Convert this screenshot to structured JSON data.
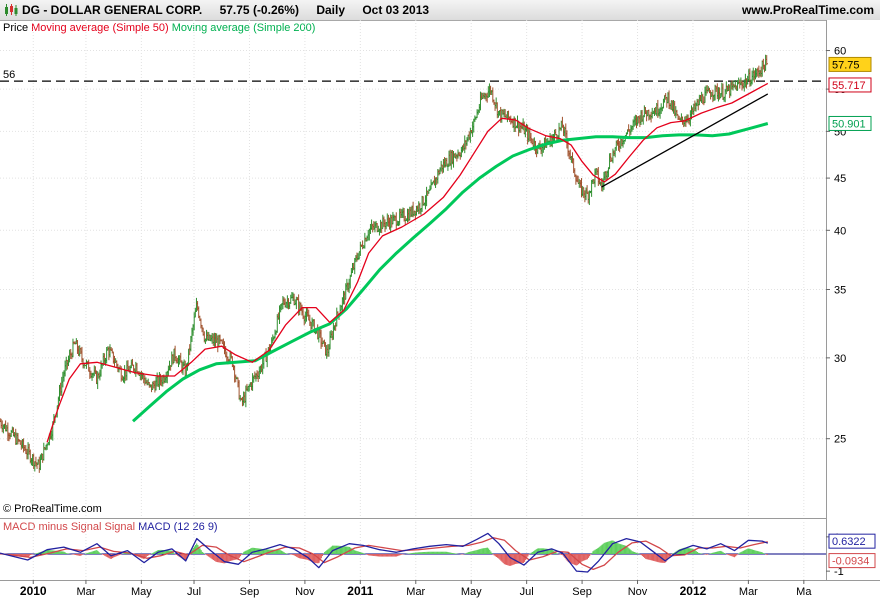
{
  "header": {
    "symbol": "DG - DOLLAR GENERAL CORP.",
    "quote": "57.75 (-0.26%)",
    "period": "Daily",
    "date": "Oct 03 2013",
    "site": "www.ProRealTime.com"
  },
  "legend": {
    "price": "Price",
    "sma50": "Moving average (Simple 50)",
    "sma200": "Moving average (Simple 200)"
  },
  "macd_legend": {
    "hist": "MACD minus Signal Signal",
    "macd": "MACD (12 26 9)"
  },
  "copyright": "© ProRealTime.com",
  "colors": {
    "price": "#2f7a2f",
    "sma50": "#e4001b",
    "sma200": "#00c85a",
    "macd_line": "#2222a0",
    "signal_line": "#d2474a",
    "hist_pos": "#5fcf5f",
    "hist_neg": "#e06060",
    "grid": "#e2e2e2",
    "current_price_bg": "#ffd21a"
  },
  "chart_data": [
    {
      "type": "line",
      "scale": "log",
      "ylim": [
        21,
        62
      ],
      "yticks": [
        25,
        30,
        35,
        40,
        45,
        50,
        55,
        60
      ],
      "xticks": [
        "2010",
        "Mar",
        "May",
        "Jul",
        "Sep",
        "Nov",
        "2011",
        "Mar",
        "May",
        "Jul",
        "Sep",
        "Nov",
        "2012",
        "Mar",
        "Ma"
      ],
      "xtick_pos": [
        0.7,
        2.6,
        4.6,
        6.5,
        8.5,
        10.5,
        12.5,
        14.5,
        16.5,
        18.5,
        20.5,
        22.5,
        24.5,
        26.5,
        28.5
      ],
      "xlim": [
        -0.5,
        29.3
      ],
      "horizontal_line": {
        "value": 56,
        "label": "56",
        "style": "dashed"
      },
      "trendline": [
        [
          21.2,
          44.1
        ],
        [
          27.2,
          54.4
        ]
      ],
      "price_points": [
        [
          -0.5,
          26.0
        ],
        [
          0.3,
          24.6
        ],
        [
          0.9,
          23.5
        ],
        [
          1.4,
          25.7
        ],
        [
          1.8,
          29.0
        ],
        [
          2.2,
          31.0
        ],
        [
          2.5,
          29.8
        ],
        [
          3.0,
          28.6
        ],
        [
          3.4,
          30.6
        ],
        [
          3.9,
          28.9
        ],
        [
          4.4,
          29.5
        ],
        [
          4.9,
          28.0
        ],
        [
          5.4,
          28.7
        ],
        [
          5.8,
          30.3
        ],
        [
          6.2,
          29.0
        ],
        [
          6.6,
          33.8
        ],
        [
          6.9,
          31.3
        ],
        [
          7.4,
          31.1
        ],
        [
          7.9,
          29.7
        ],
        [
          8.2,
          27.0
        ],
        [
          8.6,
          28.5
        ],
        [
          8.9,
          29.3
        ],
        [
          9.3,
          31.0
        ],
        [
          9.7,
          34.0
        ],
        [
          10.1,
          34.3
        ],
        [
          10.5,
          33.0
        ],
        [
          10.9,
          32.0
        ],
        [
          11.3,
          30.3
        ],
        [
          11.6,
          32.6
        ],
        [
          12.0,
          35.0
        ],
        [
          12.4,
          37.8
        ],
        [
          12.8,
          40.0
        ],
        [
          13.3,
          40.6
        ],
        [
          13.8,
          41.0
        ],
        [
          14.2,
          41.4
        ],
        [
          14.6,
          42.2
        ],
        [
          15.0,
          43.5
        ],
        [
          15.4,
          46.1
        ],
        [
          15.8,
          47.2
        ],
        [
          16.2,
          48.0
        ],
        [
          16.6,
          51.0
        ],
        [
          16.9,
          54.0
        ],
        [
          17.2,
          55.0
        ],
        [
          17.5,
          52.0
        ],
        [
          17.9,
          51.5
        ],
        [
          18.4,
          50.2
        ],
        [
          18.9,
          48.1
        ],
        [
          19.4,
          49.1
        ],
        [
          19.8,
          50.6
        ],
        [
          20.1,
          47.0
        ],
        [
          20.4,
          44.0
        ],
        [
          20.7,
          43.3
        ],
        [
          21.0,
          45.5
        ],
        [
          21.2,
          44.1
        ],
        [
          21.5,
          47.0
        ],
        [
          21.9,
          49.0
        ],
        [
          22.3,
          50.5
        ],
        [
          22.7,
          52.1
        ],
        [
          23.2,
          52.5
        ],
        [
          23.6,
          54.0
        ],
        [
          24.0,
          51.0
        ],
        [
          24.4,
          51.8
        ],
        [
          24.8,
          53.8
        ],
        [
          25.2,
          54.8
        ],
        [
          25.6,
          54.5
        ],
        [
          26.0,
          55.2
        ],
        [
          26.4,
          56.0
        ],
        [
          26.8,
          57.0
        ],
        [
          27.1,
          58.2
        ],
        [
          27.2,
          57.75
        ]
      ],
      "sma50_points": [
        [
          1.2,
          24.8
        ],
        [
          1.6,
          26.8
        ],
        [
          2.0,
          28.6
        ],
        [
          2.4,
          29.6
        ],
        [
          3.0,
          29.7
        ],
        [
          3.6,
          29.4
        ],
        [
          4.4,
          29.0
        ],
        [
          5.2,
          28.8
        ],
        [
          5.8,
          28.8
        ],
        [
          6.4,
          29.7
        ],
        [
          6.9,
          30.6
        ],
        [
          7.5,
          30.8
        ],
        [
          8.0,
          30.2
        ],
        [
          8.6,
          29.7
        ],
        [
          9.2,
          30.5
        ],
        [
          9.8,
          32.3
        ],
        [
          10.4,
          33.6
        ],
        [
          10.9,
          33.6
        ],
        [
          11.4,
          32.5
        ],
        [
          11.9,
          33.4
        ],
        [
          12.4,
          35.6
        ],
        [
          12.8,
          38.0
        ],
        [
          13.3,
          39.5
        ],
        [
          14.0,
          40.3
        ],
        [
          14.8,
          41.5
        ],
        [
          15.5,
          43.1
        ],
        [
          16.1,
          45.3
        ],
        [
          16.6,
          47.6
        ],
        [
          17.1,
          50.0
        ],
        [
          17.6,
          51.5
        ],
        [
          18.1,
          51.3
        ],
        [
          18.6,
          50.3
        ],
        [
          19.2,
          49.5
        ],
        [
          19.7,
          49.2
        ],
        [
          20.1,
          48.5
        ],
        [
          20.5,
          46.7
        ],
        [
          20.9,
          45.3
        ],
        [
          21.3,
          44.6
        ],
        [
          21.7,
          45.4
        ],
        [
          22.2,
          47.2
        ],
        [
          22.7,
          49.0
        ],
        [
          23.2,
          50.4
        ],
        [
          23.7,
          51.0
        ],
        [
          24.2,
          51.2
        ],
        [
          24.8,
          52.1
        ],
        [
          25.4,
          52.8
        ],
        [
          25.9,
          53.3
        ],
        [
          26.5,
          54.4
        ],
        [
          27.2,
          55.717
        ]
      ],
      "sma200_points": [
        [
          4.3,
          26.0
        ],
        [
          4.9,
          26.9
        ],
        [
          5.5,
          27.8
        ],
        [
          6.1,
          28.6
        ],
        [
          6.7,
          29.2
        ],
        [
          7.3,
          29.6
        ],
        [
          8.0,
          29.7
        ],
        [
          8.7,
          29.8
        ],
        [
          9.3,
          30.4
        ],
        [
          10.0,
          31.1
        ],
        [
          10.7,
          31.8
        ],
        [
          11.4,
          32.4
        ],
        [
          12.0,
          33.5
        ],
        [
          12.6,
          35.0
        ],
        [
          13.2,
          36.6
        ],
        [
          13.8,
          38.0
        ],
        [
          14.4,
          39.3
        ],
        [
          15.0,
          40.6
        ],
        [
          15.6,
          42.0
        ],
        [
          16.2,
          43.6
        ],
        [
          16.8,
          45.0
        ],
        [
          17.4,
          46.2
        ],
        [
          18.0,
          47.3
        ],
        [
          18.6,
          48.0
        ],
        [
          19.2,
          48.6
        ],
        [
          19.8,
          49.0
        ],
        [
          20.4,
          49.2
        ],
        [
          21.0,
          49.4
        ],
        [
          21.6,
          49.4
        ],
        [
          22.2,
          49.3
        ],
        [
          22.8,
          49.3
        ],
        [
          23.4,
          49.5
        ],
        [
          24.0,
          49.6
        ],
        [
          24.6,
          49.6
        ],
        [
          25.2,
          49.5
        ],
        [
          25.8,
          49.7
        ],
        [
          26.4,
          50.2
        ],
        [
          27.2,
          50.901
        ]
      ],
      "last_values": {
        "price": "57.75",
        "sma50": "55.717",
        "sma200": "50.901"
      }
    },
    {
      "type": "line",
      "name": "MACD (12 26 9)",
      "ylim": [
        -1.4,
        1.4
      ],
      "yticks": [
        1,
        -1
      ],
      "xlim": [
        -0.5,
        29.3
      ],
      "macd_points": [
        [
          -0.5,
          0.05
        ],
        [
          0.5,
          -0.35
        ],
        [
          1.2,
          0.25
        ],
        [
          1.8,
          0.4
        ],
        [
          2.4,
          0.1
        ],
        [
          3.0,
          0.6
        ],
        [
          3.5,
          -0.1
        ],
        [
          4.1,
          0.2
        ],
        [
          4.7,
          -0.5
        ],
        [
          5.2,
          0.1
        ],
        [
          5.7,
          0.3
        ],
        [
          6.2,
          -0.4
        ],
        [
          6.6,
          0.9
        ],
        [
          7.1,
          0.2
        ],
        [
          7.6,
          -0.45
        ],
        [
          8.1,
          -0.6
        ],
        [
          8.6,
          0.1
        ],
        [
          9.1,
          0.3
        ],
        [
          9.6,
          0.55
        ],
        [
          10.1,
          0.3
        ],
        [
          10.6,
          -0.2
        ],
        [
          11.0,
          -0.8
        ],
        [
          11.5,
          0.2
        ],
        [
          12.1,
          0.6
        ],
        [
          12.6,
          0.5
        ],
        [
          13.2,
          0.25
        ],
        [
          13.8,
          0.1
        ],
        [
          14.4,
          0.3
        ],
        [
          15.0,
          0.45
        ],
        [
          15.6,
          0.55
        ],
        [
          16.2,
          0.45
        ],
        [
          16.7,
          0.85
        ],
        [
          17.1,
          1.2
        ],
        [
          17.5,
          0.6
        ],
        [
          17.9,
          -0.2
        ],
        [
          18.4,
          -0.65
        ],
        [
          18.9,
          0.1
        ],
        [
          19.4,
          0.3
        ],
        [
          19.8,
          0.05
        ],
        [
          20.3,
          -1.0
        ],
        [
          20.7,
          -1.05
        ],
        [
          21.1,
          -0.4
        ],
        [
          21.6,
          0.6
        ],
        [
          22.1,
          0.9
        ],
        [
          22.6,
          0.7
        ],
        [
          23.1,
          0.1
        ],
        [
          23.5,
          -0.4
        ],
        [
          24.0,
          0.2
        ],
        [
          24.5,
          0.5
        ],
        [
          25.0,
          0.3
        ],
        [
          25.5,
          0.6
        ],
        [
          26.0,
          0.2
        ],
        [
          26.5,
          0.8
        ],
        [
          27.0,
          0.75
        ],
        [
          27.2,
          0.6322
        ]
      ],
      "signal_points": [
        [
          -0.5,
          0.02
        ],
        [
          0.6,
          -0.2
        ],
        [
          1.3,
          0.05
        ],
        [
          1.9,
          0.3
        ],
        [
          2.5,
          0.2
        ],
        [
          3.1,
          0.4
        ],
        [
          3.6,
          0.15
        ],
        [
          4.2,
          0.05
        ],
        [
          4.8,
          -0.25
        ],
        [
          5.3,
          -0.1
        ],
        [
          5.8,
          0.15
        ],
        [
          6.3,
          -0.05
        ],
        [
          6.8,
          0.5
        ],
        [
          7.3,
          0.4
        ],
        [
          7.8,
          -0.1
        ],
        [
          8.3,
          -0.45
        ],
        [
          8.8,
          -0.15
        ],
        [
          9.3,
          0.15
        ],
        [
          9.8,
          0.4
        ],
        [
          10.3,
          0.35
        ],
        [
          10.8,
          0.0
        ],
        [
          11.2,
          -0.5
        ],
        [
          11.7,
          -0.15
        ],
        [
          12.3,
          0.35
        ],
        [
          12.8,
          0.5
        ],
        [
          13.4,
          0.35
        ],
        [
          14.0,
          0.2
        ],
        [
          14.6,
          0.25
        ],
        [
          15.2,
          0.35
        ],
        [
          15.8,
          0.45
        ],
        [
          16.4,
          0.5
        ],
        [
          16.9,
          0.7
        ],
        [
          17.3,
          0.95
        ],
        [
          17.7,
          0.8
        ],
        [
          18.1,
          0.2
        ],
        [
          18.6,
          -0.35
        ],
        [
          19.1,
          -0.15
        ],
        [
          19.6,
          0.15
        ],
        [
          20.0,
          0.1
        ],
        [
          20.5,
          -0.6
        ],
        [
          20.9,
          -0.9
        ],
        [
          21.3,
          -0.65
        ],
        [
          21.8,
          0.1
        ],
        [
          22.3,
          0.65
        ],
        [
          22.8,
          0.75
        ],
        [
          23.3,
          0.35
        ],
        [
          23.7,
          -0.1
        ],
        [
          24.2,
          -0.05
        ],
        [
          24.7,
          0.35
        ],
        [
          25.2,
          0.35
        ],
        [
          25.7,
          0.45
        ],
        [
          26.2,
          0.35
        ],
        [
          26.7,
          0.55
        ],
        [
          27.2,
          0.72
        ]
      ],
      "last_values": {
        "macd": "0.6322",
        "hist": "-0.0934"
      }
    }
  ]
}
